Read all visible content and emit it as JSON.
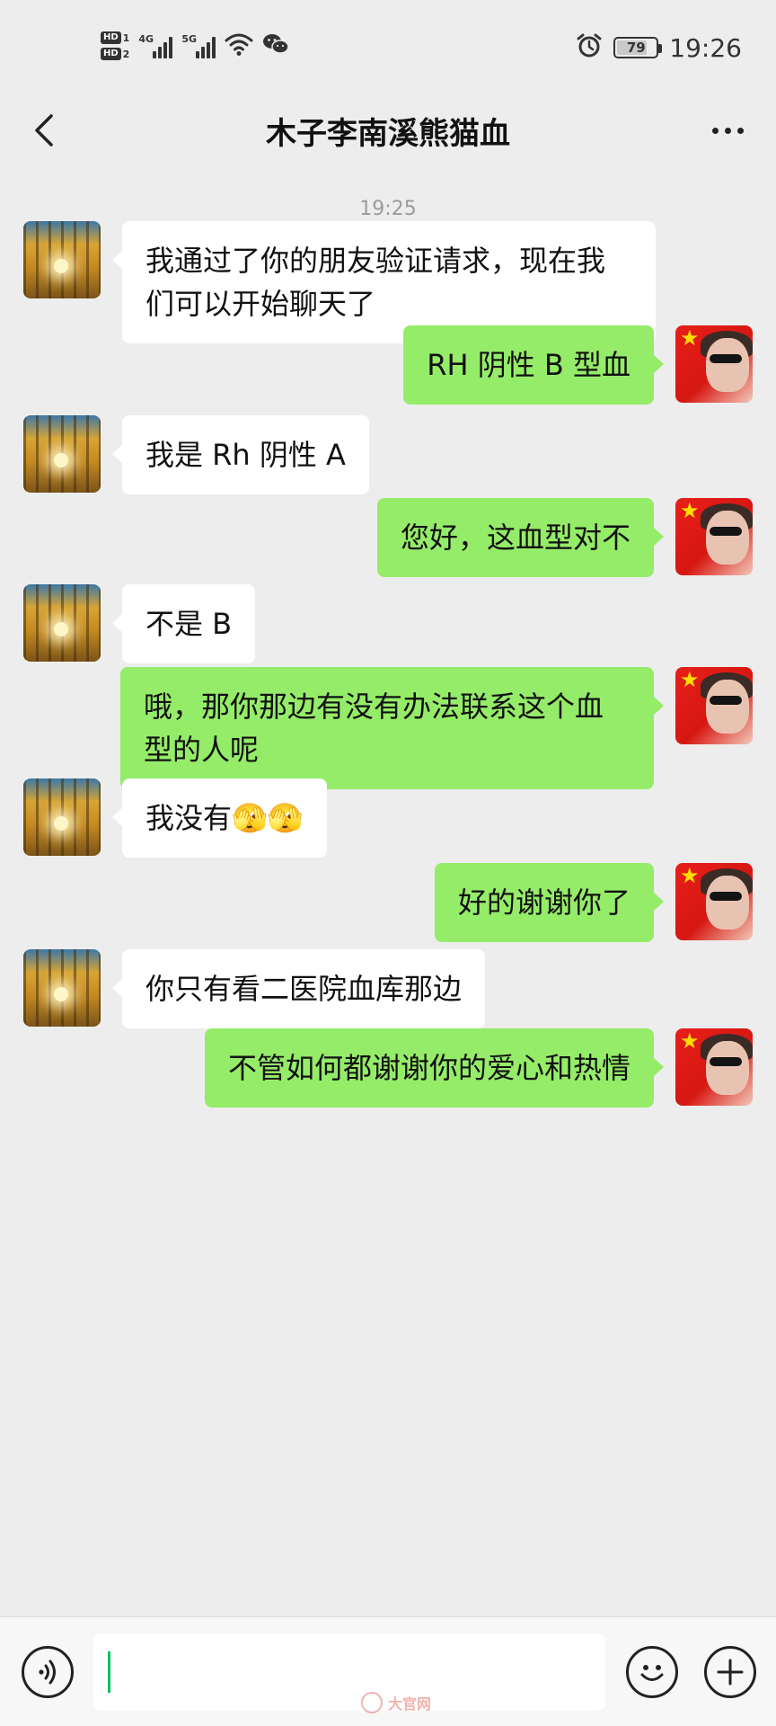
{
  "status_bar": {
    "sim1_label": "HD",
    "sim1_slot": "1",
    "sim2_label": "HD",
    "sim2_slot": "2",
    "signal1_type": "4G",
    "signal2_type": "5G",
    "battery_level": "79",
    "time": "19:26",
    "icons": [
      "wifi-icon",
      "wechat-notification-icon",
      "alarm-icon",
      "battery-icon"
    ]
  },
  "nav": {
    "title": "木子李南溪熊猫血",
    "icons": [
      "back-arrow-icon",
      "more-dots-icon"
    ]
  },
  "chat": {
    "timestamp": "19:25",
    "messages": [
      {
        "side": "in",
        "text": "我通过了你的朋友验证请求，现在我们可以开始聊天了"
      },
      {
        "side": "out",
        "text": "RH 阴性 B 型血"
      },
      {
        "side": "in",
        "text": "我是 Rh 阴性 A"
      },
      {
        "side": "out",
        "text": "您好，这血型对不"
      },
      {
        "side": "in",
        "text": "不是 B"
      },
      {
        "side": "out",
        "text": "哦，那你那边有没有办法联系这个血型的人呢"
      },
      {
        "side": "in",
        "text": "我没有🫣🫣"
      },
      {
        "side": "out",
        "text": "好的谢谢你了"
      },
      {
        "side": "in",
        "text": "你只有看二医院血库那边"
      },
      {
        "side": "out",
        "text": "不管如何都谢谢你的爱心和热情"
      }
    ],
    "avatars": {
      "contact": "forest-avatar",
      "self": "flag-sunglasses-avatar"
    }
  },
  "input_bar": {
    "message_value": "",
    "icons": [
      "voice-icon",
      "emoji-icon",
      "plus-icon"
    ]
  },
  "watermark": {
    "text": "大官网"
  },
  "colors": {
    "background": "#ededed",
    "incoming_bubble": "#ffffff",
    "outgoing_bubble": "#95ec69",
    "accent_caret": "#07c160",
    "timestamp": "#9b9b9b"
  }
}
